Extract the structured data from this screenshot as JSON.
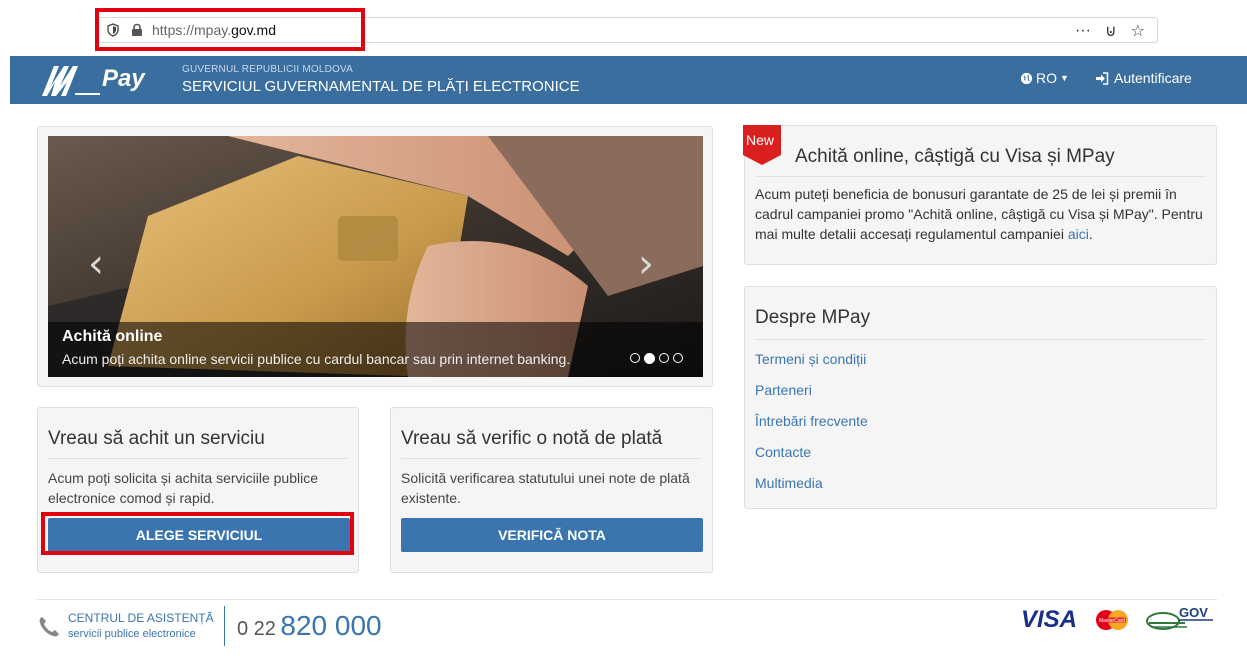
{
  "browser": {
    "url_rest": "https://mpay.",
    "url_domain": "gov.md",
    "menu_icon": "more-dots-icon",
    "pocket_icon": "pocket-icon",
    "star_icon": "star-icon",
    "more_label": "···",
    "pocket_label": "⊍",
    "star_label": "☆"
  },
  "header": {
    "logo_text": "Pay",
    "gov_small": "GUVERNUL REPUBLICII MOLDOVA",
    "gov_big": "SERVICIUL GUVERNAMENTAL DE PLĂȚI ELECTRONICE",
    "lang_label": "RO",
    "login_label": "Autentificare",
    "accent": "#3a6e9e"
  },
  "carousel": {
    "caption_title": "Achită online",
    "caption_text": "Acum poți achita online servicii publice cu cardul bancar sau prin internet banking.",
    "prev_arrow": "‹",
    "next_arrow": "›",
    "slides": 4,
    "active_slide": 2
  },
  "service_pay": {
    "title": "Vreau să achit un serviciu",
    "text": "Acum poți solicita și achita serviciile publice electronice comod și rapid.",
    "button": "ALEGE SERVICIUL"
  },
  "service_verify": {
    "title": "Vreau să verific o notă de plată",
    "text": "Solicită verificarea statutului unei note de plată existente.",
    "button": "VERIFICĂ NOTA"
  },
  "promo": {
    "badge": "New",
    "title": "Achită online, câștigă cu Visa și MPay",
    "text": "Acum puteți beneficia de bonusuri garantate de 25 de lei și premii în cadrul campaniei promo \"Achită online, câștigă cu Visa și MPay\". Pentru mai multe detalii accesați regulamentul campaniei ",
    "link": "aici",
    "after_link": "."
  },
  "about": {
    "title": "Despre MPay",
    "links": [
      "Termeni și condiții",
      "Parteneri",
      "Întrebări frecvente",
      "Contacte",
      "Multimedia"
    ]
  },
  "footer": {
    "help_title": "CENTRUL DE ASISTENȚĂ",
    "help_sub": "servicii publice electronice",
    "phone_prefix": "0 22",
    "phone_main": "820 000",
    "visa": "VISA",
    "mastercard": "MasterCard",
    "gov": "GOV"
  }
}
